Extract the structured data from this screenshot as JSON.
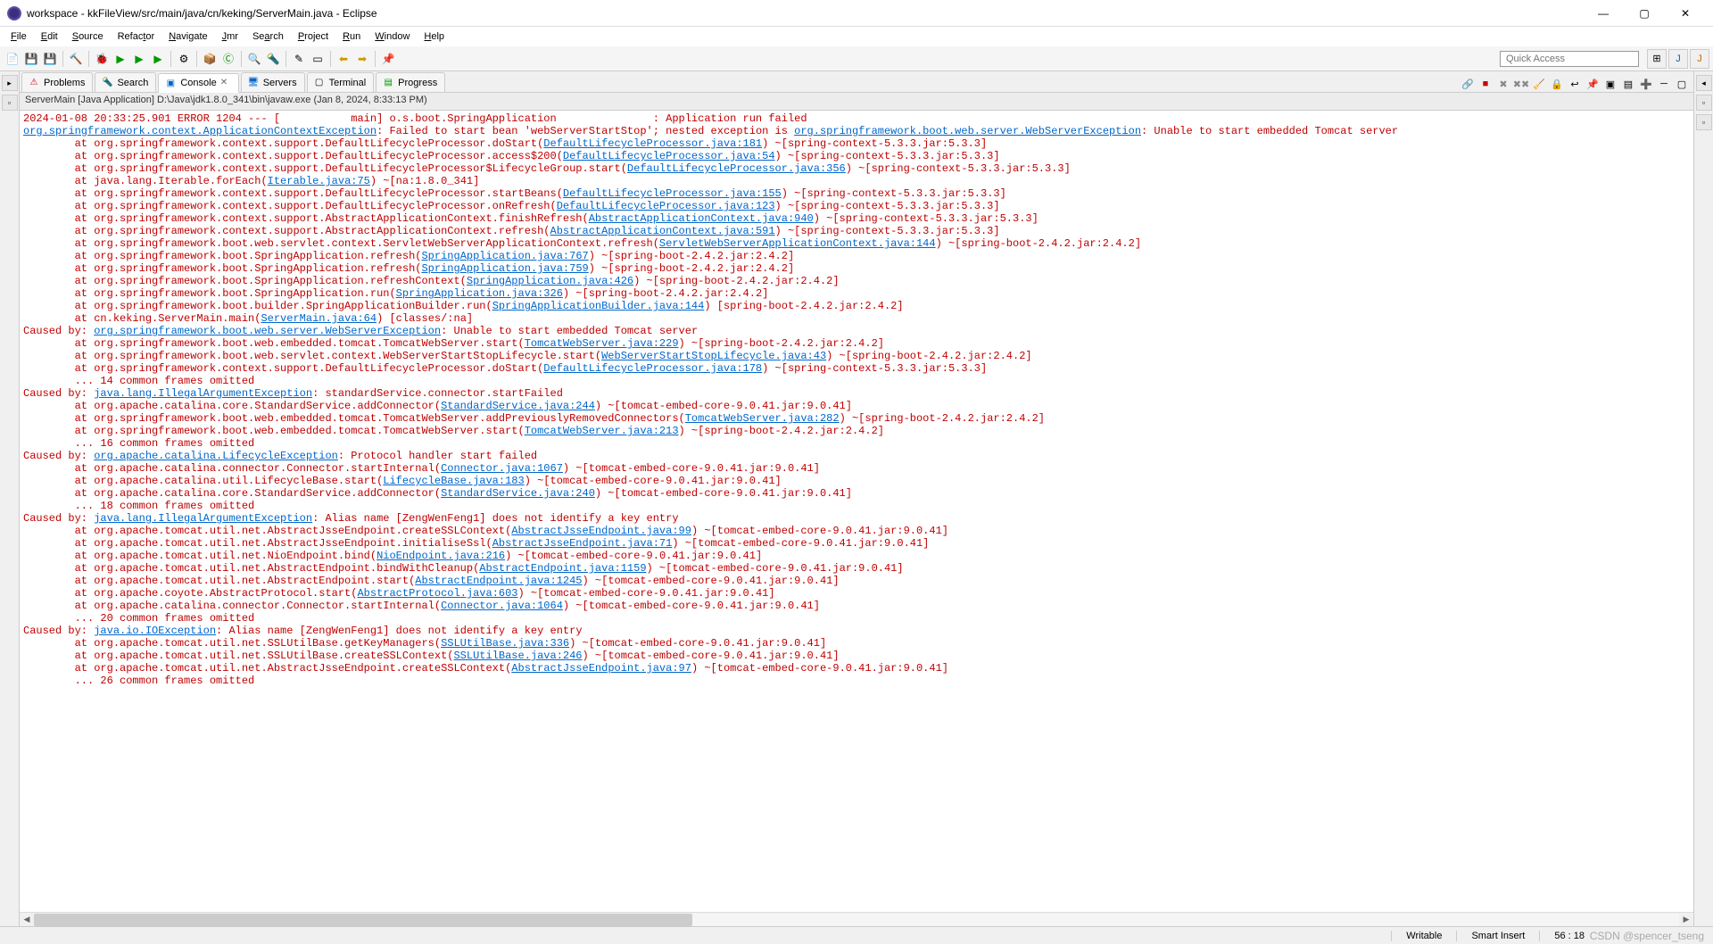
{
  "window": {
    "title": "workspace - kkFileView/src/main/java/cn/keking/ServerMain.java - Eclipse",
    "minimize": "—",
    "maximize": "▢",
    "close": "✕"
  },
  "menu": {
    "file": "File",
    "edit": "Edit",
    "source": "Source",
    "refactor": "Refactor",
    "navigate": "Navigate",
    "jmr": "Jmr",
    "search": "Search",
    "project": "Project",
    "run": "Run",
    "window": "Window",
    "help": "Help"
  },
  "quick_access": {
    "placeholder": "Quick Access"
  },
  "tabs": {
    "problems": "Problems",
    "search": "Search",
    "console": "Console",
    "servers": "Servers",
    "terminal": "Terminal",
    "progress": "Progress"
  },
  "launch": {
    "info": "ServerMain [Java Application] D:\\Java\\jdk1.8.0_341\\bin\\javaw.exe (Jan 8, 2024, 8:33:13 PM)"
  },
  "console_lines": [
    {
      "t": "err",
      "s": [
        {
          "p": "2024-01-08 20:33:25.901 ERROR 1204 --- [           main] o.s.boot.SpringApplication               : Application run failed"
        }
      ]
    },
    {
      "t": "err",
      "s": [
        {
          "p": ""
        }
      ]
    },
    {
      "t": "err",
      "s": [
        {
          "l": "org.springframework.context.ApplicationContextException"
        },
        {
          "p": ": Failed to start bean 'webServerStartStop'; nested exception is "
        },
        {
          "l": "org.springframework.boot.web.server.WebServerException"
        },
        {
          "p": ": Unable to start embedded Tomcat server"
        }
      ]
    },
    {
      "t": "err",
      "s": [
        {
          "p": "        at org.springframework.context.support.DefaultLifecycleProcessor.doStart("
        },
        {
          "l": "DefaultLifecycleProcessor.java:181"
        },
        {
          "p": ") ~[spring-context-5.3.3.jar:5.3.3]"
        }
      ]
    },
    {
      "t": "err",
      "s": [
        {
          "p": "        at org.springframework.context.support.DefaultLifecycleProcessor.access$200("
        },
        {
          "l": "DefaultLifecycleProcessor.java:54"
        },
        {
          "p": ") ~[spring-context-5.3.3.jar:5.3.3]"
        }
      ]
    },
    {
      "t": "err",
      "s": [
        {
          "p": "        at org.springframework.context.support.DefaultLifecycleProcessor$LifecycleGroup.start("
        },
        {
          "l": "DefaultLifecycleProcessor.java:356"
        },
        {
          "p": ") ~[spring-context-5.3.3.jar:5.3.3]"
        }
      ]
    },
    {
      "t": "err",
      "s": [
        {
          "p": "        at java.lang.Iterable.forEach("
        },
        {
          "l": "Iterable.java:75"
        },
        {
          "p": ") ~[na:1.8.0_341]"
        }
      ]
    },
    {
      "t": "err",
      "s": [
        {
          "p": "        at org.springframework.context.support.DefaultLifecycleProcessor.startBeans("
        },
        {
          "l": "DefaultLifecycleProcessor.java:155"
        },
        {
          "p": ") ~[spring-context-5.3.3.jar:5.3.3]"
        }
      ]
    },
    {
      "t": "err",
      "s": [
        {
          "p": "        at org.springframework.context.support.DefaultLifecycleProcessor.onRefresh("
        },
        {
          "l": "DefaultLifecycleProcessor.java:123"
        },
        {
          "p": ") ~[spring-context-5.3.3.jar:5.3.3]"
        }
      ]
    },
    {
      "t": "err",
      "s": [
        {
          "p": "        at org.springframework.context.support.AbstractApplicationContext.finishRefresh("
        },
        {
          "l": "AbstractApplicationContext.java:940"
        },
        {
          "p": ") ~[spring-context-5.3.3.jar:5.3.3]"
        }
      ]
    },
    {
      "t": "err",
      "s": [
        {
          "p": "        at org.springframework.context.support.AbstractApplicationContext.refresh("
        },
        {
          "l": "AbstractApplicationContext.java:591"
        },
        {
          "p": ") ~[spring-context-5.3.3.jar:5.3.3]"
        }
      ]
    },
    {
      "t": "err",
      "s": [
        {
          "p": "        at org.springframework.boot.web.servlet.context.ServletWebServerApplicationContext.refresh("
        },
        {
          "l": "ServletWebServerApplicationContext.java:144"
        },
        {
          "p": ") ~[spring-boot-2.4.2.jar:2.4.2]"
        }
      ]
    },
    {
      "t": "err",
      "s": [
        {
          "p": "        at org.springframework.boot.SpringApplication.refresh("
        },
        {
          "l": "SpringApplication.java:767"
        },
        {
          "p": ") ~[spring-boot-2.4.2.jar:2.4.2]"
        }
      ]
    },
    {
      "t": "err",
      "s": [
        {
          "p": "        at org.springframework.boot.SpringApplication.refresh("
        },
        {
          "l": "SpringApplication.java:759"
        },
        {
          "p": ") ~[spring-boot-2.4.2.jar:2.4.2]"
        }
      ]
    },
    {
      "t": "err",
      "s": [
        {
          "p": "        at org.springframework.boot.SpringApplication.refreshContext("
        },
        {
          "l": "SpringApplication.java:426"
        },
        {
          "p": ") ~[spring-boot-2.4.2.jar:2.4.2]"
        }
      ]
    },
    {
      "t": "err",
      "s": [
        {
          "p": "        at org.springframework.boot.SpringApplication.run("
        },
        {
          "l": "SpringApplication.java:326"
        },
        {
          "p": ") ~[spring-boot-2.4.2.jar:2.4.2]"
        }
      ]
    },
    {
      "t": "err",
      "s": [
        {
          "p": "        at org.springframework.boot.builder.SpringApplicationBuilder.run("
        },
        {
          "l": "SpringApplicationBuilder.java:144"
        },
        {
          "p": ") [spring-boot-2.4.2.jar:2.4.2]"
        }
      ]
    },
    {
      "t": "err",
      "s": [
        {
          "p": "        at cn.keking.ServerMain.main("
        },
        {
          "l": "ServerMain.java:64"
        },
        {
          "p": ") [classes/:na]"
        }
      ]
    },
    {
      "t": "err",
      "s": [
        {
          "p": "Caused by: "
        },
        {
          "l": "org.springframework.boot.web.server.WebServerException"
        },
        {
          "p": ": Unable to start embedded Tomcat server"
        }
      ]
    },
    {
      "t": "err",
      "s": [
        {
          "p": "        at org.springframework.boot.web.embedded.tomcat.TomcatWebServer.start("
        },
        {
          "l": "TomcatWebServer.java:229"
        },
        {
          "p": ") ~[spring-boot-2.4.2.jar:2.4.2]"
        }
      ]
    },
    {
      "t": "err",
      "s": [
        {
          "p": "        at org.springframework.boot.web.servlet.context.WebServerStartStopLifecycle.start("
        },
        {
          "l": "WebServerStartStopLifecycle.java:43"
        },
        {
          "p": ") ~[spring-boot-2.4.2.jar:2.4.2]"
        }
      ]
    },
    {
      "t": "err",
      "s": [
        {
          "p": "        at org.springframework.context.support.DefaultLifecycleProcessor.doStart("
        },
        {
          "l": "DefaultLifecycleProcessor.java:178"
        },
        {
          "p": ") ~[spring-context-5.3.3.jar:5.3.3]"
        }
      ]
    },
    {
      "t": "err",
      "s": [
        {
          "p": "        ... 14 common frames omitted"
        }
      ]
    },
    {
      "t": "err",
      "s": [
        {
          "p": "Caused by: "
        },
        {
          "l": "java.lang.IllegalArgumentException"
        },
        {
          "p": ": standardService.connector.startFailed"
        }
      ]
    },
    {
      "t": "err",
      "s": [
        {
          "p": "        at org.apache.catalina.core.StandardService.addConnector("
        },
        {
          "l": "StandardService.java:244"
        },
        {
          "p": ") ~[tomcat-embed-core-9.0.41.jar:9.0.41]"
        }
      ]
    },
    {
      "t": "err",
      "s": [
        {
          "p": "        at org.springframework.boot.web.embedded.tomcat.TomcatWebServer.addPreviouslyRemovedConnectors("
        },
        {
          "l": "TomcatWebServer.java:282"
        },
        {
          "p": ") ~[spring-boot-2.4.2.jar:2.4.2]"
        }
      ]
    },
    {
      "t": "err",
      "s": [
        {
          "p": "        at org.springframework.boot.web.embedded.tomcat.TomcatWebServer.start("
        },
        {
          "l": "TomcatWebServer.java:213"
        },
        {
          "p": ") ~[spring-boot-2.4.2.jar:2.4.2]"
        }
      ]
    },
    {
      "t": "err",
      "s": [
        {
          "p": "        ... 16 common frames omitted"
        }
      ]
    },
    {
      "t": "err",
      "s": [
        {
          "p": "Caused by: "
        },
        {
          "l": "org.apache.catalina.LifecycleException"
        },
        {
          "p": ": Protocol handler start failed"
        }
      ]
    },
    {
      "t": "err",
      "s": [
        {
          "p": "        at org.apache.catalina.connector.Connector.startInternal("
        },
        {
          "l": "Connector.java:1067"
        },
        {
          "p": ") ~[tomcat-embed-core-9.0.41.jar:9.0.41]"
        }
      ]
    },
    {
      "t": "err",
      "s": [
        {
          "p": "        at org.apache.catalina.util.LifecycleBase.start("
        },
        {
          "l": "LifecycleBase.java:183"
        },
        {
          "p": ") ~[tomcat-embed-core-9.0.41.jar:9.0.41]"
        }
      ]
    },
    {
      "t": "err",
      "s": [
        {
          "p": "        at org.apache.catalina.core.StandardService.addConnector("
        },
        {
          "l": "StandardService.java:240"
        },
        {
          "p": ") ~[tomcat-embed-core-9.0.41.jar:9.0.41]"
        }
      ]
    },
    {
      "t": "err",
      "s": [
        {
          "p": "        ... 18 common frames omitted"
        }
      ]
    },
    {
      "t": "err",
      "s": [
        {
          "p": "Caused by: "
        },
        {
          "l": "java.lang.IllegalArgumentException"
        },
        {
          "p": ": Alias name [ZengWenFeng1] does not identify a key entry"
        }
      ]
    },
    {
      "t": "err",
      "s": [
        {
          "p": "        at org.apache.tomcat.util.net.AbstractJsseEndpoint.createSSLContext("
        },
        {
          "l": "AbstractJsseEndpoint.java:99"
        },
        {
          "p": ") ~[tomcat-embed-core-9.0.41.jar:9.0.41]"
        }
      ]
    },
    {
      "t": "err",
      "s": [
        {
          "p": "        at org.apache.tomcat.util.net.AbstractJsseEndpoint.initialiseSsl("
        },
        {
          "l": "AbstractJsseEndpoint.java:71"
        },
        {
          "p": ") ~[tomcat-embed-core-9.0.41.jar:9.0.41]"
        }
      ]
    },
    {
      "t": "err",
      "s": [
        {
          "p": "        at org.apache.tomcat.util.net.NioEndpoint.bind("
        },
        {
          "l": "NioEndpoint.java:216"
        },
        {
          "p": ") ~[tomcat-embed-core-9.0.41.jar:9.0.41]"
        }
      ]
    },
    {
      "t": "err",
      "s": [
        {
          "p": "        at org.apache.tomcat.util.net.AbstractEndpoint.bindWithCleanup("
        },
        {
          "l": "AbstractEndpoint.java:1159"
        },
        {
          "p": ") ~[tomcat-embed-core-9.0.41.jar:9.0.41]"
        }
      ]
    },
    {
      "t": "err",
      "s": [
        {
          "p": "        at org.apache.tomcat.util.net.AbstractEndpoint.start("
        },
        {
          "l": "AbstractEndpoint.java:1245"
        },
        {
          "p": ") ~[tomcat-embed-core-9.0.41.jar:9.0.41]"
        }
      ]
    },
    {
      "t": "err",
      "s": [
        {
          "p": "        at org.apache.coyote.AbstractProtocol.start("
        },
        {
          "l": "AbstractProtocol.java:603"
        },
        {
          "p": ") ~[tomcat-embed-core-9.0.41.jar:9.0.41]"
        }
      ]
    },
    {
      "t": "err",
      "s": [
        {
          "p": "        at org.apache.catalina.connector.Connector.startInternal("
        },
        {
          "l": "Connector.java:1064"
        },
        {
          "p": ") ~[tomcat-embed-core-9.0.41.jar:9.0.41]"
        }
      ]
    },
    {
      "t": "err",
      "s": [
        {
          "p": "        ... 20 common frames omitted"
        }
      ]
    },
    {
      "t": "err",
      "s": [
        {
          "p": "Caused by: "
        },
        {
          "l": "java.io.IOException"
        },
        {
          "p": ": Alias name [ZengWenFeng1] does not identify a key entry"
        }
      ]
    },
    {
      "t": "err",
      "s": [
        {
          "p": "        at org.apache.tomcat.util.net.SSLUtilBase.getKeyManagers("
        },
        {
          "l": "SSLUtilBase.java:336"
        },
        {
          "p": ") ~[tomcat-embed-core-9.0.41.jar:9.0.41]"
        }
      ]
    },
    {
      "t": "err",
      "s": [
        {
          "p": "        at org.apache.tomcat.util.net.SSLUtilBase.createSSLContext("
        },
        {
          "l": "SSLUtilBase.java:246"
        },
        {
          "p": ") ~[tomcat-embed-core-9.0.41.jar:9.0.41]"
        }
      ]
    },
    {
      "t": "err",
      "s": [
        {
          "p": "        at org.apache.tomcat.util.net.AbstractJsseEndpoint.createSSLContext("
        },
        {
          "l": "AbstractJsseEndpoint.java:97"
        },
        {
          "p": ") ~[tomcat-embed-core-9.0.41.jar:9.0.41]"
        }
      ]
    },
    {
      "t": "err",
      "s": [
        {
          "p": "        ... 26 common frames omitted"
        }
      ]
    },
    {
      "t": "err",
      "s": [
        {
          "p": ""
        }
      ]
    }
  ],
  "status": {
    "writable": "Writable",
    "insert": "Smart Insert",
    "pos": "56 : 18"
  },
  "watermark": "CSDN @spencer_tseng"
}
